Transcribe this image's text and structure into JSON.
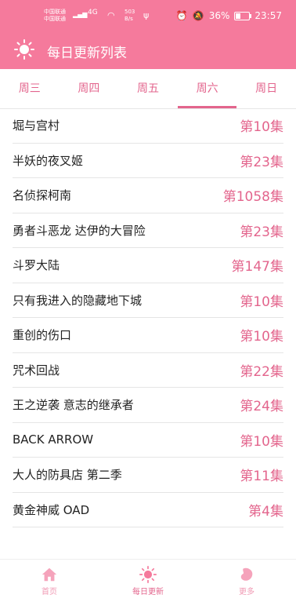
{
  "status_bar": {
    "carrier_line1": "中国联通",
    "carrier_line2": "中国联通",
    "signal_text": "5G",
    "network_text": "4G",
    "rate_line1": "503",
    "rate_line2": "B/s",
    "battery": "36%",
    "time": "23:57"
  },
  "app_bar": {
    "title": "每日更新列表",
    "icon": "sun-icon"
  },
  "tabs": [
    {
      "label": "周三",
      "active": false
    },
    {
      "label": "周四",
      "active": false
    },
    {
      "label": "周五",
      "active": false
    },
    {
      "label": "周六",
      "active": true
    },
    {
      "label": "周日",
      "active": false
    }
  ],
  "items": [
    {
      "name": "堀与宫村",
      "episode": "第10集"
    },
    {
      "name": "半妖的夜叉姬",
      "episode": "第23集"
    },
    {
      "name": "名侦探柯南",
      "episode": "第1058集"
    },
    {
      "name": "勇者斗恶龙 达伊的大冒险",
      "episode": "第23集"
    },
    {
      "name": "斗罗大陆",
      "episode": "第147集"
    },
    {
      "name": "只有我进入的隐藏地下城",
      "episode": "第10集"
    },
    {
      "name": "重创的伤口",
      "episode": "第10集"
    },
    {
      "name": "咒术回战",
      "episode": "第22集"
    },
    {
      "name": "王之逆袭 意志的继承者",
      "episode": "第24集"
    },
    {
      "name": "BACK ARROW",
      "episode": "第10集"
    },
    {
      "name": "大人的防具店 第二季",
      "episode": "第11集"
    },
    {
      "name": "黄金神威 OAD",
      "episode": "第4集"
    }
  ],
  "bottom_nav": [
    {
      "label": "首页",
      "icon": "home-icon"
    },
    {
      "label": "每日更新",
      "icon": "sun-icon"
    },
    {
      "label": "更多",
      "icon": "bean-icon"
    }
  ],
  "colors": {
    "accent": "#f57a9c",
    "text_accent": "#e3658d"
  }
}
